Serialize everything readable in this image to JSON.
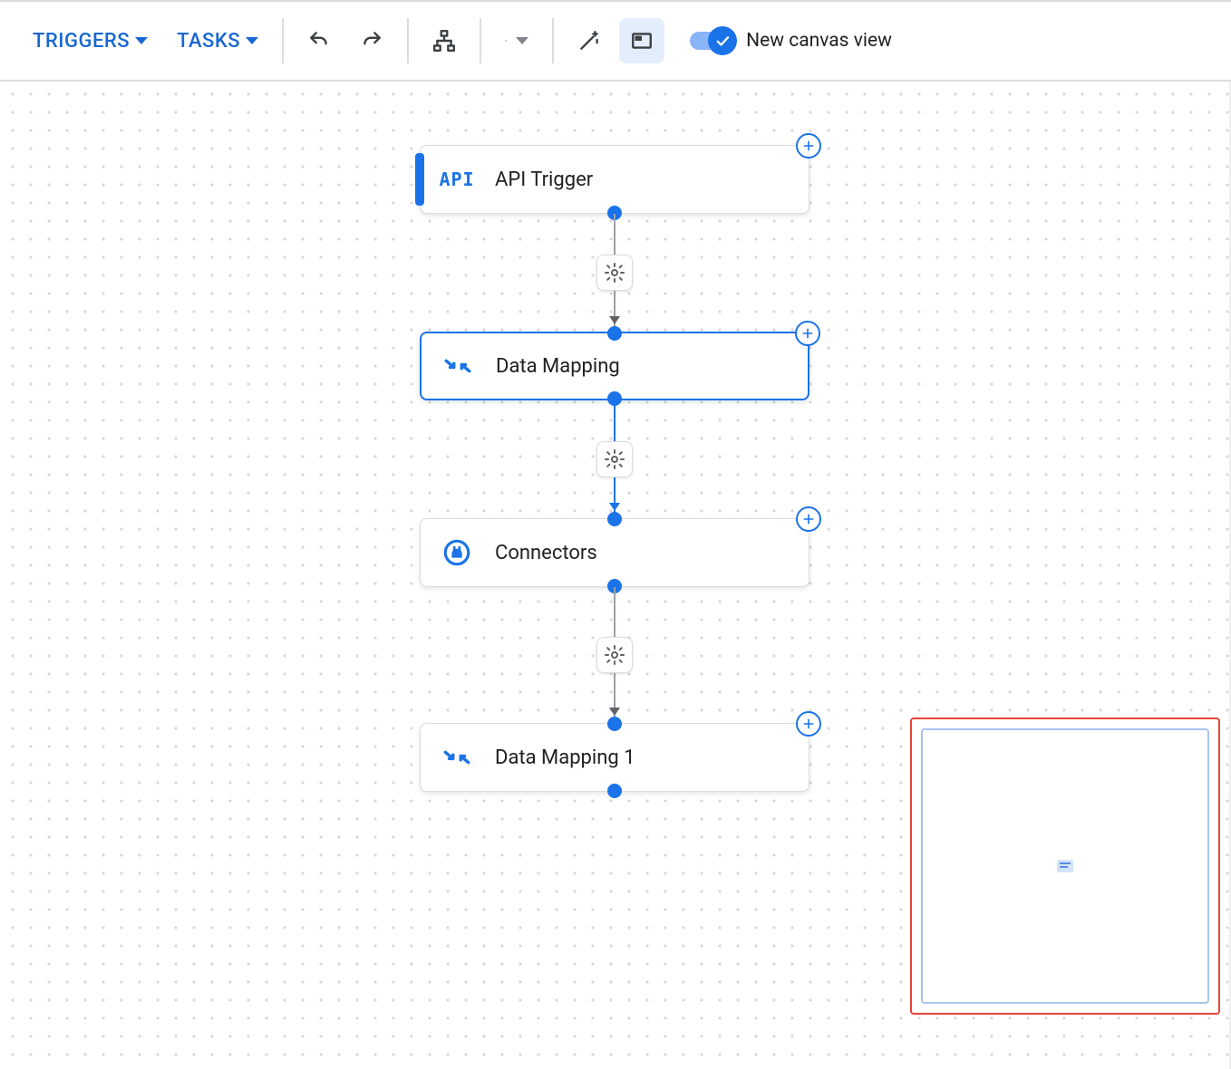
{
  "toolbar": {
    "triggers_label": "TRIGGERS",
    "tasks_label": "TASKS",
    "toggle_label": "New canvas view",
    "toggle_on": true
  },
  "nodes": [
    {
      "id": "api_trigger",
      "type": "trigger",
      "label": "API Trigger",
      "icon": "api",
      "selected": false,
      "has_api_badge": true
    },
    {
      "id": "data_mapping",
      "type": "task",
      "label": "Data Mapping",
      "icon": "data-map",
      "selected": true,
      "has_api_badge": false
    },
    {
      "id": "connectors",
      "type": "task",
      "label": "Connectors",
      "icon": "connector",
      "selected": false,
      "has_api_badge": false
    },
    {
      "id": "data_mapping_1",
      "type": "task",
      "label": "Data Mapping 1",
      "icon": "data-map",
      "selected": false,
      "has_api_badge": false
    }
  ],
  "edges": [
    {
      "from": "api_trigger",
      "to": "data_mapping",
      "has_config": true
    },
    {
      "from": "data_mapping",
      "to": "connectors",
      "has_config": true
    },
    {
      "from": "connectors",
      "to": "data_mapping_1",
      "has_config": true
    }
  ],
  "minimap": {
    "highlighted": true
  }
}
